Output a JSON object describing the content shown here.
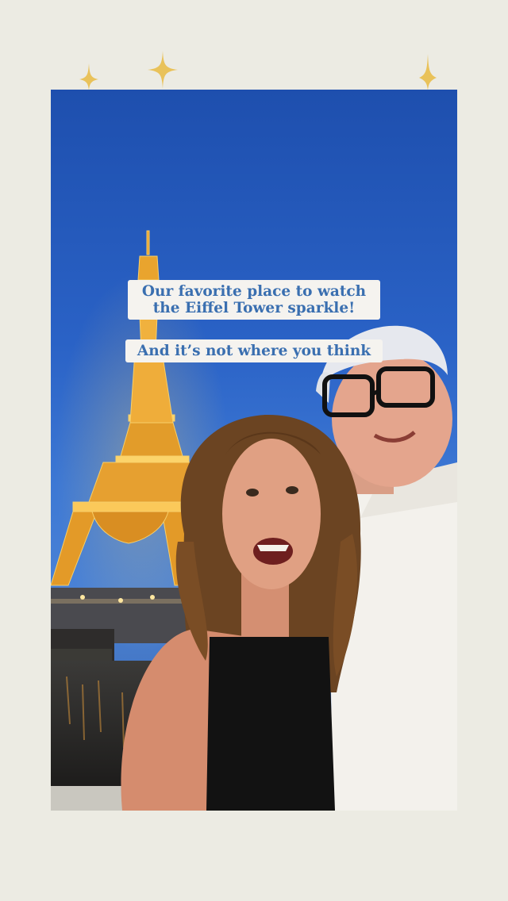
{
  "captions": {
    "line1": "Our favorite place to watch",
    "line2": "the Eiffel Tower sparkle!",
    "line3": "And it’s not where you think"
  },
  "colors": {
    "background": "#ecebe3",
    "sky": "#2a62c6",
    "caption_bg": "#f5f3ef",
    "caption_text": "#3a6fb0",
    "tower_glow": "#f2b23c",
    "sparkle": "#e9c25a"
  },
  "icons": [
    "sparkle-icon",
    "sparkle-icon",
    "sparkle-icon"
  ]
}
